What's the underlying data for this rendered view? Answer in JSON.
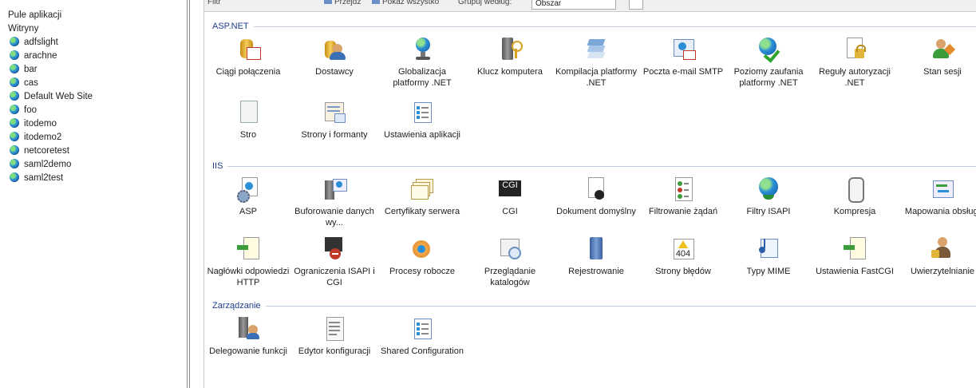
{
  "tree": {
    "app_pools_label": "Pule aplikacji",
    "sites_label": "Witryny",
    "sites": [
      "adfslight",
      "arachne",
      "bar",
      "cas",
      "Default Web Site",
      "foo",
      "itodemo",
      "itodemo2",
      "netcoretest",
      "saml2demo",
      "saml2test"
    ]
  },
  "filter_bar": {
    "filter_label": "Filtr",
    "go_label": "Przejdź",
    "show_all_label": "Pokaż wszystko",
    "group_by_label": "Grupuj według:",
    "group_by_value": "Obszar"
  },
  "sections": [
    {
      "title": "ASP.NET",
      "features": [
        {
          "label": "Ciągi połączenia",
          "icon": "connection-strings-icon"
        },
        {
          "label": "Dostawcy",
          "icon": "providers-icon"
        },
        {
          "label": "Globalizacja platformy .NET",
          "icon": "globalization-icon"
        },
        {
          "label": "Klucz komputera",
          "icon": "machine-key-icon"
        },
        {
          "label": "Kompilacja platformy .NET",
          "icon": "compilation-icon"
        },
        {
          "label": "Poczta e-mail SMTP",
          "icon": "smtp-email-icon"
        },
        {
          "label": "Poziomy zaufania platformy .NET",
          "icon": "trust-levels-icon"
        },
        {
          "label": "Reguły autoryzacji .NET",
          "icon": "authorization-rules-icon"
        },
        {
          "label": "Stan sesji",
          "icon": "session-state-icon"
        },
        {
          "label": "Stro",
          "icon": "pages-icon"
        },
        {
          "label": "Strony i formanty",
          "icon": "pages-controls-icon"
        },
        {
          "label": "Ustawienia aplikacji",
          "icon": "app-settings-icon"
        }
      ]
    },
    {
      "title": "IIS",
      "features": [
        {
          "label": "ASP",
          "icon": "asp-icon"
        },
        {
          "label": "Buforowanie danych wy...",
          "icon": "output-caching-icon"
        },
        {
          "label": "Certyfikaty serwera",
          "icon": "server-certificates-icon"
        },
        {
          "label": "CGI",
          "icon": "cgi-icon"
        },
        {
          "label": "Dokument domyślny",
          "icon": "default-document-icon"
        },
        {
          "label": "Filtrowanie żądań",
          "icon": "request-filtering-icon"
        },
        {
          "label": "Filtry ISAPI",
          "icon": "isapi-filters-icon"
        },
        {
          "label": "Kompresja",
          "icon": "compression-icon"
        },
        {
          "label": "Mapowania obsługi",
          "icon": "handler-mappings-icon"
        },
        {
          "label": "Nagłówki odpowiedzi HTTP",
          "icon": "http-headers-icon"
        },
        {
          "label": "Ograniczenia ISAPI i CGI",
          "icon": "isapi-cgi-restrictions-icon"
        },
        {
          "label": "Procesy robocze",
          "icon": "worker-processes-icon"
        },
        {
          "label": "Przeglądanie katalogów",
          "icon": "directory-browsing-icon"
        },
        {
          "label": "Rejestrowanie",
          "icon": "logging-icon"
        },
        {
          "label": "Strony błędów",
          "icon": "error-pages-icon"
        },
        {
          "label": "Typy MIME",
          "icon": "mime-types-icon"
        },
        {
          "label": "Ustawienia FastCGI",
          "icon": "fastcgi-settings-icon"
        },
        {
          "label": "Uwierzytelnianie",
          "icon": "authentication-icon"
        }
      ]
    },
    {
      "title": "Zarządzanie",
      "features": [
        {
          "label": "Delegowanie funkcji",
          "icon": "feature-delegation-icon"
        },
        {
          "label": "Edytor konfiguracji",
          "icon": "configuration-editor-icon"
        },
        {
          "label": "Shared Configuration",
          "icon": "shared-configuration-icon"
        }
      ]
    }
  ],
  "icon_text": {
    "cgi": "CGI",
    "error_code": "404"
  }
}
